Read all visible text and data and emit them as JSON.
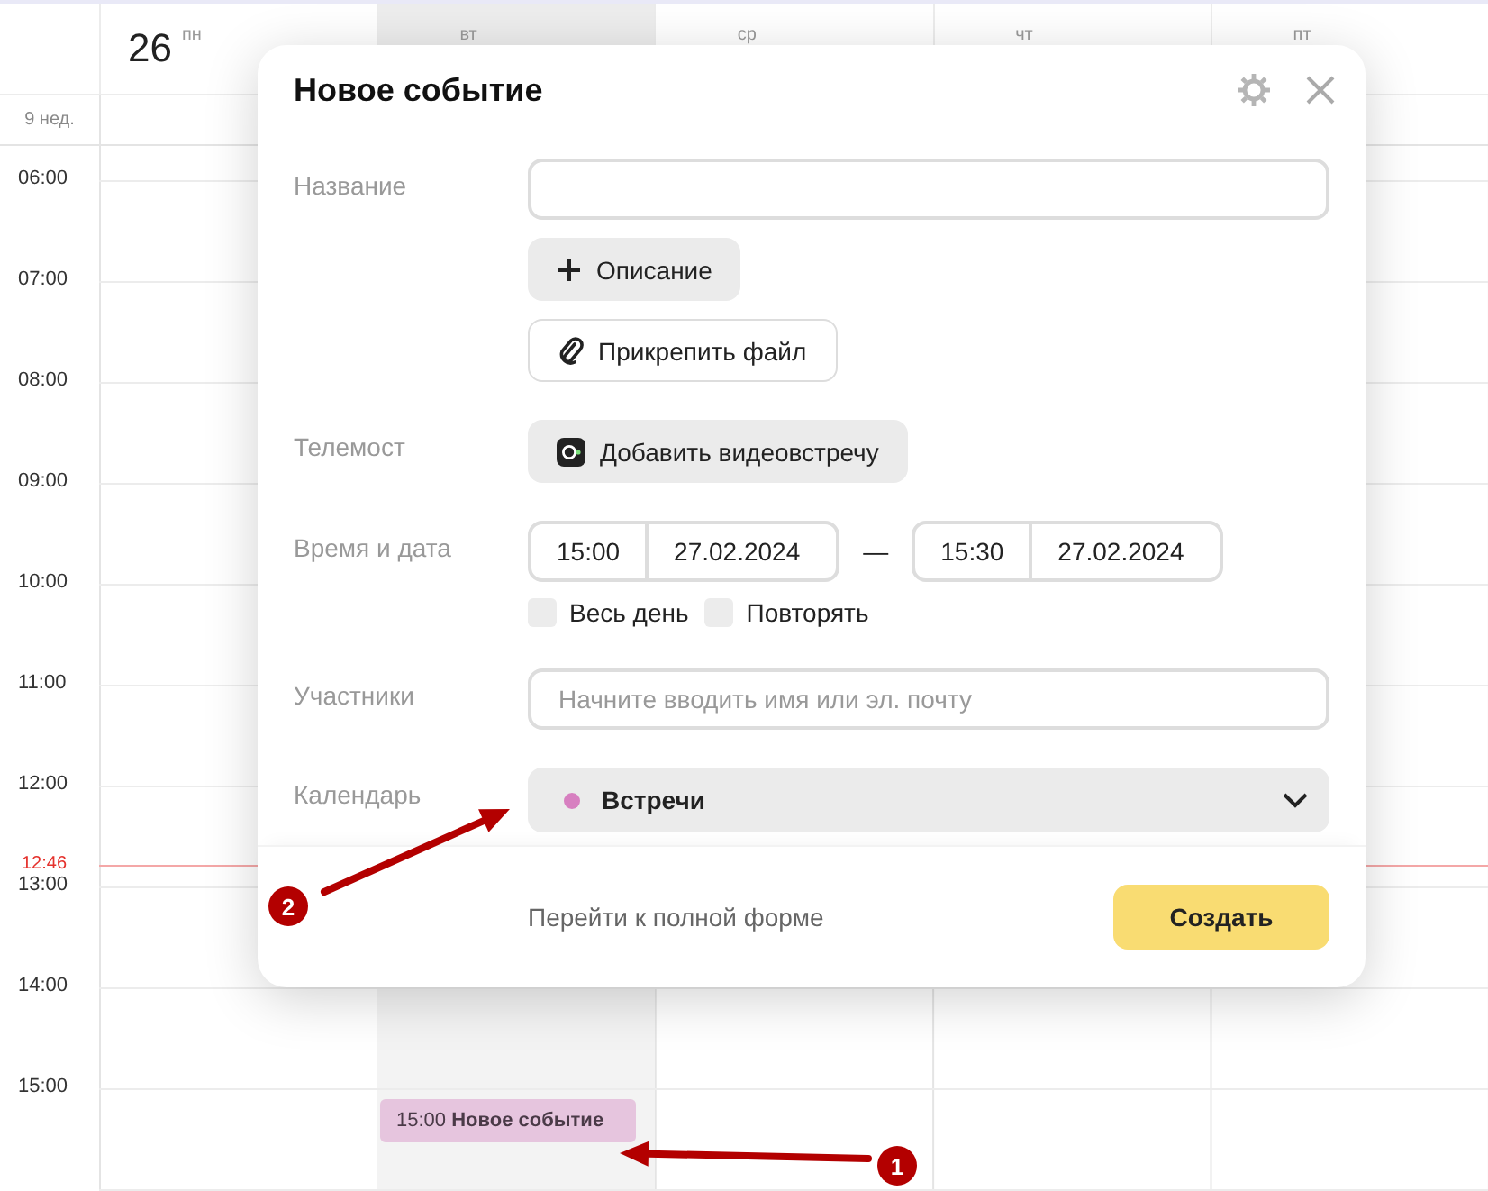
{
  "calendar": {
    "week_label": "9 нед.",
    "days": [
      {
        "number": "26",
        "weekday": "пн",
        "selected": false
      },
      {
        "weekday": "вт",
        "selected": true
      },
      {
        "weekday": "ср",
        "selected": false
      },
      {
        "weekday": "чт",
        "selected": false
      },
      {
        "weekday": "пт",
        "selected": false
      }
    ],
    "hours": [
      "06:00",
      "07:00",
      "08:00",
      "09:00",
      "10:00",
      "11:00",
      "12:00",
      "13:00",
      "14:00",
      "15:00"
    ],
    "now_marker": "12:46",
    "events": [
      {
        "text": "15:00 **Новое событие**"
      }
    ]
  },
  "dialog": {
    "title": "Новое событие",
    "name_label": "Название",
    "description_button": "Описание",
    "attach_button": "Прикрепить файл",
    "telemost_label": "Телемост",
    "video_button": "Добавить видеовстречу",
    "datetime_label": "Время и дата",
    "start_time": "15:00",
    "start_date": "27.02.2024",
    "dash": "—",
    "end_time": "15:30",
    "end_date": "27.02.2024",
    "checkboxes": [
      {
        "label": "Весь день",
        "checked": false
      },
      {
        "label": "Повторять",
        "checked": false
      }
    ],
    "participants_label": "Участники",
    "participants_placeholder": "Начните вводить имя или эл. почту",
    "calendar_label": "Календарь",
    "calendar_value": "Встречи",
    "full_form_link": "Перейти к полной форме",
    "create_button": "Создать"
  },
  "annotations": [
    {
      "number": "1"
    },
    {
      "number": "2"
    }
  ]
}
